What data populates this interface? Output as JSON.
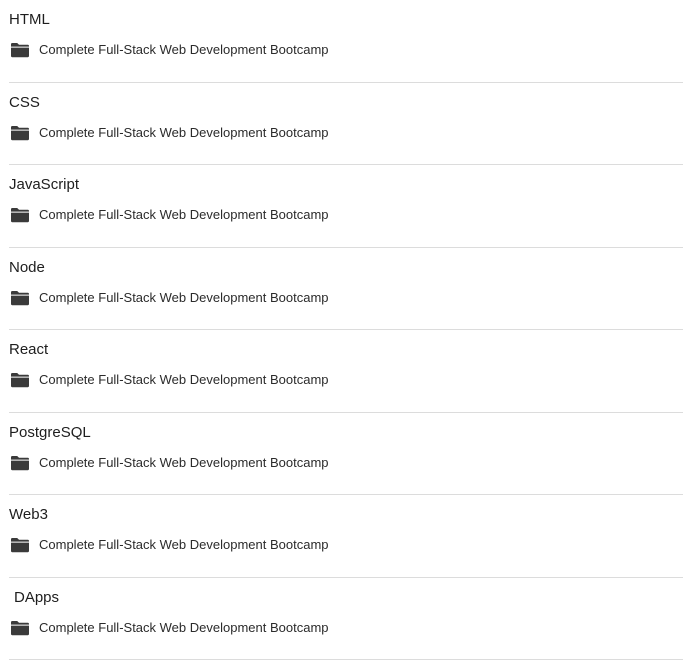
{
  "items": [
    {
      "title": "HTML",
      "subtitle": "Complete Full-Stack Web Development Bootcamp",
      "icon": "folder-icon"
    },
    {
      "title": "CSS",
      "subtitle": "Complete Full-Stack Web Development Bootcamp",
      "icon": "folder-icon"
    },
    {
      "title": "JavaScript",
      "subtitle": "Complete Full-Stack Web Development Bootcamp",
      "icon": "folder-icon"
    },
    {
      "title": "Node",
      "subtitle": "Complete Full-Stack Web Development Bootcamp",
      "icon": "folder-icon"
    },
    {
      "title": "React",
      "subtitle": "Complete Full-Stack Web Development Bootcamp",
      "icon": "folder-icon"
    },
    {
      "title": "PostgreSQL",
      "subtitle": "Complete Full-Stack Web Development Bootcamp",
      "icon": "folder-icon"
    },
    {
      "title": "Web3",
      "subtitle": "Complete Full-Stack Web Development Bootcamp",
      "icon": "folder-icon"
    },
    {
      "title": "DApps",
      "subtitle": "Complete Full-Stack Web Development Bootcamp",
      "icon": "folder-icon"
    }
  ],
  "colors": {
    "text": "#1e1e1e",
    "icon": "#3a3a3a",
    "divider": "#dcdcdc",
    "background": "#ffffff"
  }
}
